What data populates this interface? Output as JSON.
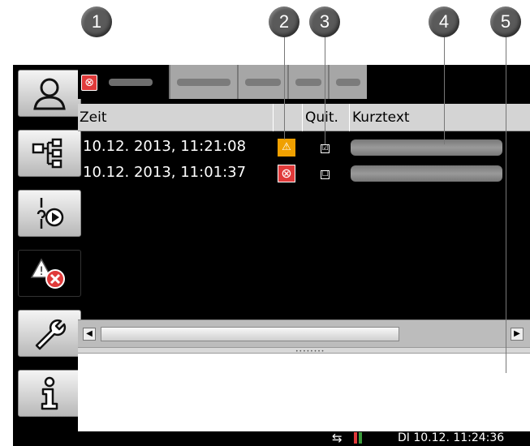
{
  "callouts": [
    "1",
    "2",
    "3",
    "4",
    "5"
  ],
  "table": {
    "headers": {
      "time": "Zeit",
      "ack": "Quit.",
      "text": "Kurztext"
    },
    "rows": [
      {
        "time": "10.12. 2013, 11:21:08",
        "type": "warning",
        "ack": "☑"
      },
      {
        "time": "10.12. 2013, 11:01:37",
        "type": "error",
        "ack": "☐"
      }
    ]
  },
  "status": {
    "datetime": "DI 10.12. 11:24:36"
  },
  "icons": {
    "sidebar": [
      "user-icon",
      "hierarchy-icon",
      "process-play-icon",
      "alarm-icon",
      "wrench-icon",
      "info-icon"
    ],
    "row_types": {
      "warning": "⚠",
      "error": "⊗"
    }
  },
  "colors": {
    "error": "#e03a3a",
    "warning": "#f0a000",
    "background": "#000000"
  }
}
